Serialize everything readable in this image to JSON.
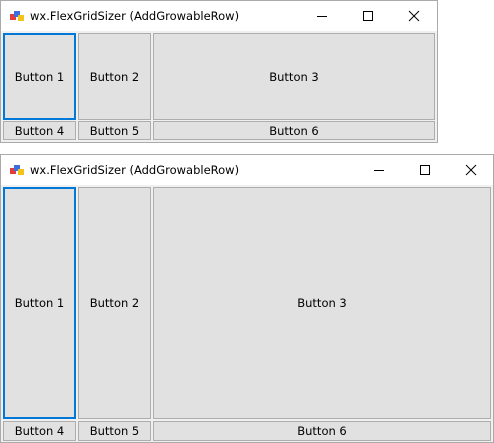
{
  "windows": [
    {
      "title": "wx.FlexGridSizer (AddGrowableRow)",
      "buttons": [
        "Button 1",
        "Button 2",
        "Button 3",
        "Button 4",
        "Button 5",
        "Button 6"
      ],
      "focused_button": "Button 1"
    },
    {
      "title": "wx.FlexGridSizer (AddGrowableRow)",
      "buttons": [
        "Button 1",
        "Button 2",
        "Button 3",
        "Button 4",
        "Button 5",
        "Button 6"
      ],
      "focused_button": "Button 1"
    }
  ],
  "controls": {
    "minimize_icon": "minimize-icon",
    "maximize_icon": "maximize-icon",
    "close_icon": "close-icon",
    "app_icon": "wx-app-icon"
  },
  "colors": {
    "focus_border": "#0078d7",
    "button_face": "#e1e1e1",
    "button_border": "#adadad",
    "window_bg": "#f0f0f0",
    "titlebar_bg": "#ffffff"
  }
}
